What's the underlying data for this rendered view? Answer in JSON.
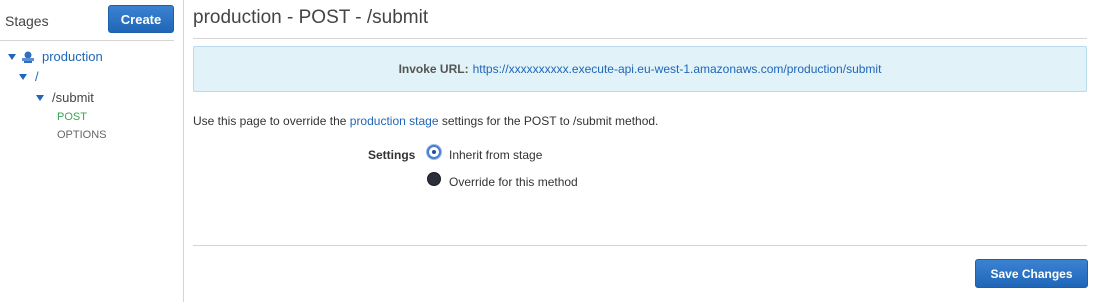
{
  "sidebar": {
    "title": "Stages",
    "create_label": "Create",
    "tree": {
      "stage": "production",
      "root": "/",
      "resource": "/submit",
      "methods": [
        "POST",
        "OPTIONS"
      ]
    }
  },
  "main": {
    "title": "production - POST - /submit",
    "invoke": {
      "label": "Invoke URL:",
      "url": "https://xxxxxxxxxx.execute-api.eu-west-1.amazonaws.com/production/submit"
    },
    "description": {
      "prefix": "Use this page to override the",
      "link": "production stage",
      "suffix": "settings for the POST to /submit method."
    },
    "settings": {
      "label": "Settings",
      "options": [
        {
          "label": "Inherit from stage",
          "selected": true
        },
        {
          "label": "Override for this method",
          "selected": false
        }
      ]
    },
    "save_label": "Save Changes"
  },
  "colors": {
    "accent": "#1f66b8",
    "active_method": "#3aa654",
    "invoke_bg": "#e1f2f9"
  }
}
